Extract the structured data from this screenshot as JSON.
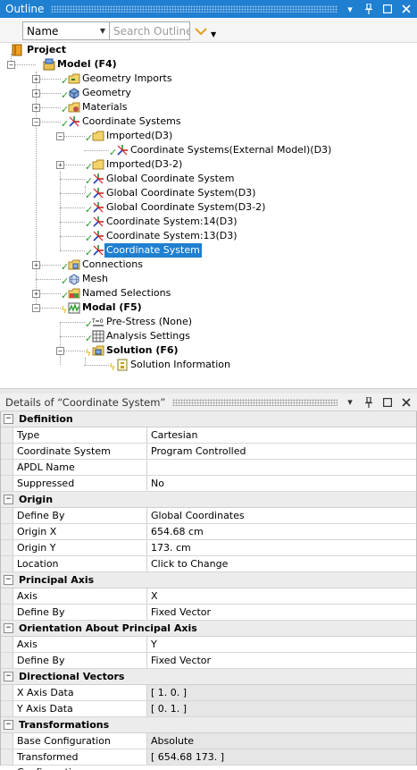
{
  "outline": {
    "title": "Outline",
    "toolbar": {
      "name_select_value": "Name",
      "search_placeholder": "Search Outline"
    },
    "tree": [
      {
        "label": "Project",
        "bold": true,
        "icon": "project-icon",
        "level": 0
      },
      {
        "label": "Model (F4)",
        "bold": true,
        "icon": "model-icon",
        "level": 1,
        "expander": "minus"
      },
      {
        "label": "Geometry Imports",
        "icon": "geometry-imports-icon",
        "level": 2,
        "expander": "plus",
        "status": "check"
      },
      {
        "label": "Geometry",
        "icon": "geometry-icon",
        "level": 2,
        "expander": "plus",
        "status": "check"
      },
      {
        "label": "Materials",
        "icon": "materials-icon",
        "level": 2,
        "expander": "plus",
        "status": "check"
      },
      {
        "label": "Coordinate Systems",
        "icon": "coordinate-systems-icon",
        "level": 2,
        "expander": "minus",
        "status": "check"
      },
      {
        "label": "Imported(D3)",
        "icon": "folder-icon",
        "level": 3,
        "expander": "minus",
        "status": "check"
      },
      {
        "label": "Coordinate Systems(External Model)(D3)",
        "icon": "coordinate-system-icon",
        "level": 4,
        "status": "check"
      },
      {
        "label": "Imported(D3-2)",
        "icon": "folder-icon",
        "level": 3,
        "expander": "plus",
        "status": "check"
      },
      {
        "label": "Global Coordinate System",
        "icon": "coordinate-system-icon",
        "level": 3,
        "status": "check"
      },
      {
        "label": "Global Coordinate System(D3)",
        "icon": "coordinate-system-icon",
        "level": 3,
        "status": "check"
      },
      {
        "label": "Global Coordinate System(D3-2)",
        "icon": "coordinate-system-icon",
        "level": 3,
        "status": "check"
      },
      {
        "label": "Coordinate System:14(D3)",
        "icon": "coordinate-system-icon",
        "level": 3,
        "status": "check"
      },
      {
        "label": "Coordinate System:13(D3)",
        "icon": "coordinate-system-icon",
        "level": 3,
        "status": "check"
      },
      {
        "label": "Coordinate System",
        "icon": "coordinate-system-icon",
        "level": 3,
        "status": "check",
        "selected": true
      },
      {
        "label": "Connections",
        "icon": "connections-icon",
        "level": 2,
        "expander": "plus",
        "status": "check"
      },
      {
        "label": "Mesh",
        "icon": "mesh-icon",
        "level": 2,
        "status": "check"
      },
      {
        "label": "Named Selections",
        "icon": "named-selections-icon",
        "level": 2,
        "expander": "plus",
        "status": "check"
      },
      {
        "label": "Modal (F5)",
        "bold": true,
        "icon": "modal-icon",
        "level": 2,
        "expander": "minus",
        "status": "bolt"
      },
      {
        "label": "Pre-Stress (None)",
        "icon": "pre-stress-icon",
        "level": 3,
        "status": "check"
      },
      {
        "label": "Analysis Settings",
        "icon": "analysis-settings-icon",
        "level": 3,
        "status": "check"
      },
      {
        "label": "Solution (F6)",
        "bold": true,
        "icon": "solution-icon",
        "level": 3,
        "expander": "minus",
        "status": "bolt"
      },
      {
        "label": "Solution Information",
        "icon": "solution-information-icon",
        "level": 4,
        "status": "bolt"
      }
    ]
  },
  "details": {
    "title": "Details of “Coordinate System”",
    "sections": [
      {
        "label": "Definition",
        "rows": [
          {
            "key": "Type",
            "value": "Cartesian"
          },
          {
            "key": "Coordinate System",
            "value": "Program Controlled"
          },
          {
            "key": "APDL Name",
            "value": ""
          },
          {
            "key": "Suppressed",
            "value": "No"
          }
        ]
      },
      {
        "label": "Origin",
        "rows": [
          {
            "key": "Define By",
            "value": "Global Coordinates"
          },
          {
            "key": "Origin X",
            "value": "654.68 cm"
          },
          {
            "key": "Origin Y",
            "value": "173. cm"
          },
          {
            "key": "Location",
            "value": "Click to Change"
          }
        ]
      },
      {
        "label": "Principal Axis",
        "rows": [
          {
            "key": "Axis",
            "value": "X"
          },
          {
            "key": "Define By",
            "value": "Fixed Vector"
          }
        ]
      },
      {
        "label": "Orientation About Principal Axis",
        "rows": [
          {
            "key": "Axis",
            "value": "Y"
          },
          {
            "key": "Define By",
            "value": "Fixed Vector"
          }
        ]
      },
      {
        "label": "Directional Vectors",
        "rows": [
          {
            "key": "X Axis Data",
            "value": "[ 1.  0. ]",
            "readonly": true
          },
          {
            "key": "Y Axis Data",
            "value": "[ 0.  1. ]",
            "readonly": true
          }
        ]
      },
      {
        "label": "Transformations",
        "rows": [
          {
            "key": "Base Configuration",
            "value": "Absolute",
            "readonly": true
          },
          {
            "key": "Transformed Configuration",
            "value": "[ 654.68  173. ]",
            "readonly": true
          }
        ]
      }
    ]
  },
  "colors": {
    "title_bar": "#1f7fd0",
    "selection": "#1f7fd0",
    "check": "#2a9a2a",
    "bolt": "#d9b400"
  }
}
